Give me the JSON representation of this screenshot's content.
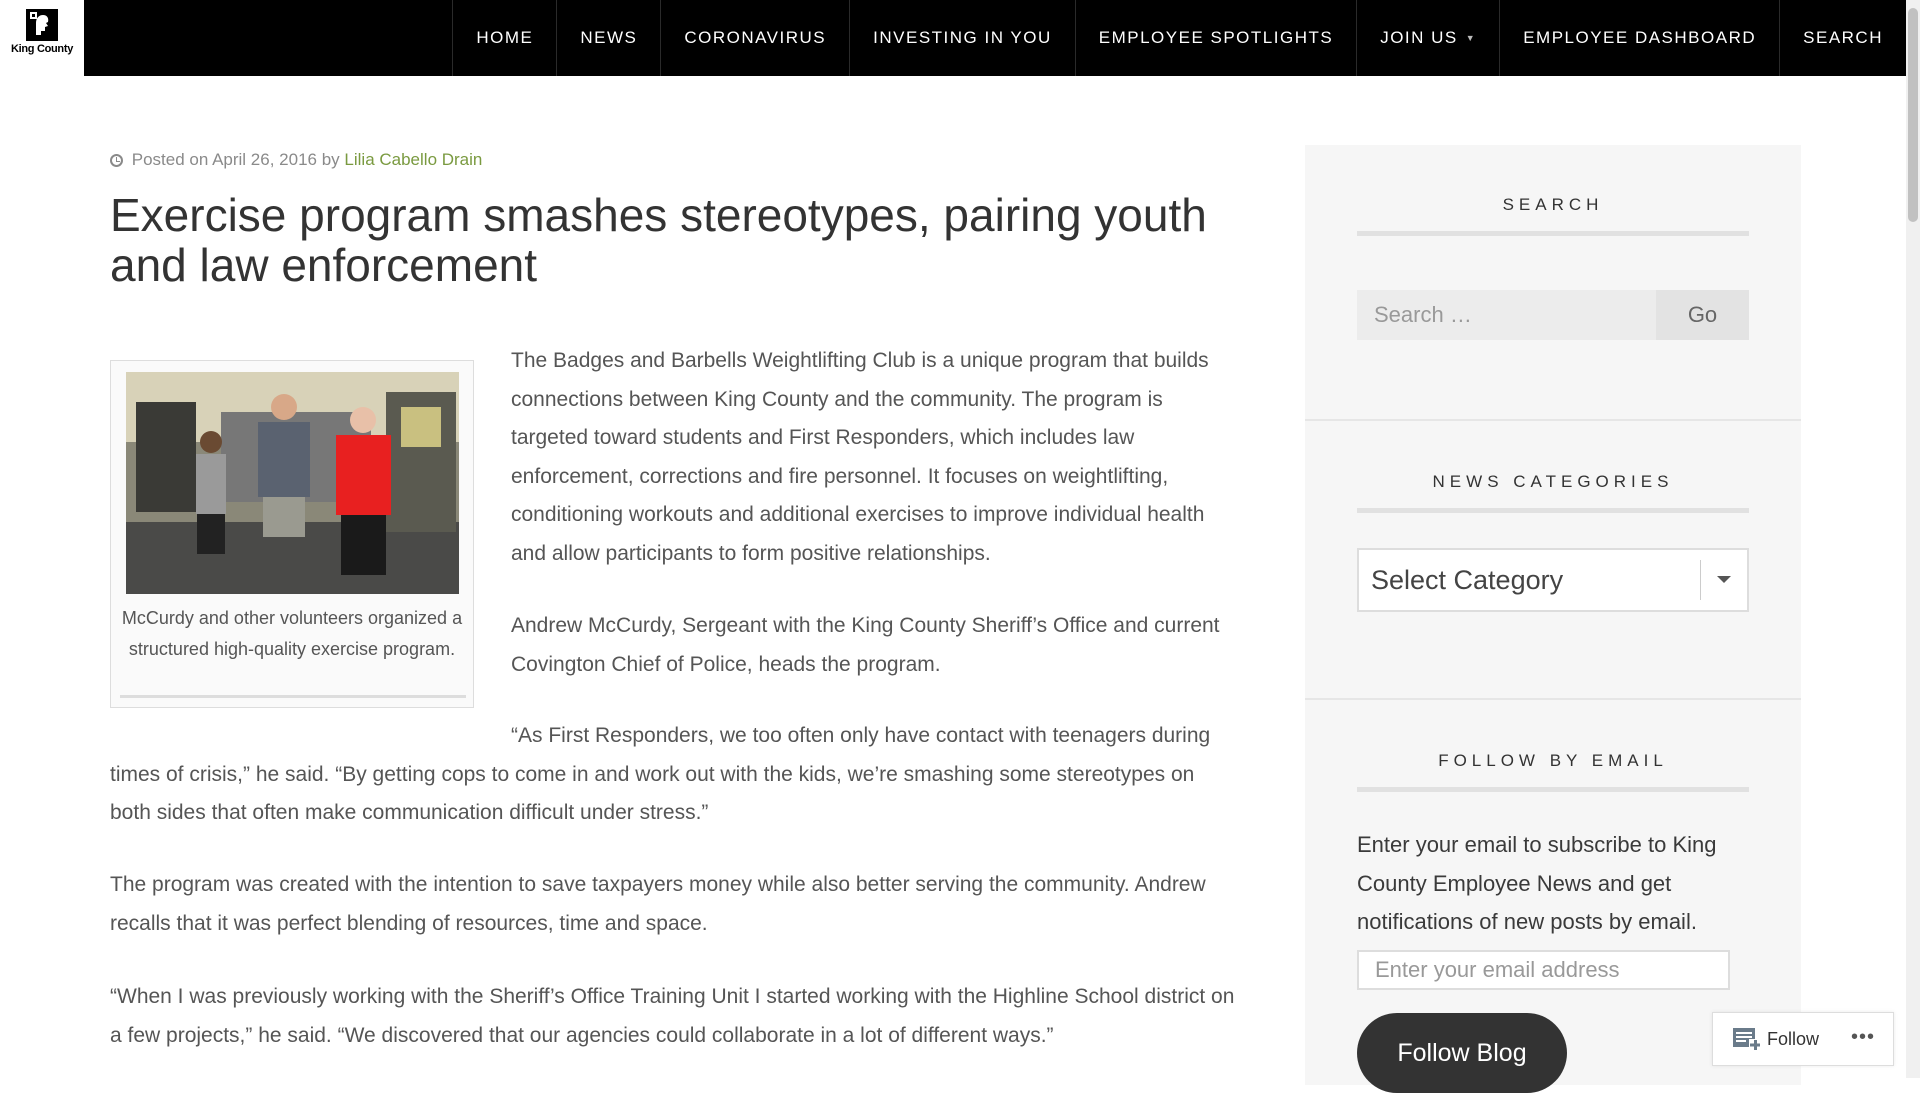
{
  "header": {
    "logo_text": "King County",
    "nav": [
      {
        "label": "HOME"
      },
      {
        "label": "NEWS"
      },
      {
        "label": "CORONAVIRUS"
      },
      {
        "label": "INVESTING IN YOU"
      },
      {
        "label": "EMPLOYEE SPOTLIGHTS"
      },
      {
        "label": "JOIN US"
      },
      {
        "label": "EMPLOYEE DASHBOARD"
      },
      {
        "label": "SEARCH"
      }
    ]
  },
  "article": {
    "meta_prefix": "Posted on April 26, 2016 by",
    "author": "Lilia Cabello Drain",
    "title": "Exercise program smashes stereotypes, pairing youth and law enforcement",
    "figure_caption": "McCurdy and other volunteers organized a structured high-quality exercise program.",
    "paragraphs": [
      "The Badges and Barbells Weightlifting Club is a unique program that builds connections between King County and the community. The program is targeted toward students and First Responders, which includes law enforcement, corrections and fire personnel. It focuses on weightlifting, conditioning workouts and additional exercises to improve individual health and allow participants to form positive relationships.",
      "Andrew McCurdy, Sergeant with the King County Sheriff’s Office and current Covington Chief of Police, heads the program.",
      "“As First Responders, we too often only have contact with teenagers during times of crisis,” he said. “By getting cops to come in and work out with the kids, we’re smashing some stereotypes on both sides that often make communication difficult under stress.”",
      "The program was created with the intention to save taxpayers money while also better serving the community. Andrew recalls that it was perfect blending of resources, time and space.",
      "“When I was previously working with the Sheriff’s Office Training Unit I started working with the Highline School district on a few projects,” he said. “We discovered that our agencies could collaborate in a lot of different ways.”"
    ]
  },
  "sidebar": {
    "search": {
      "title": "SEARCH",
      "placeholder": "Search …",
      "button": "Go"
    },
    "categories": {
      "title": "NEWS CATEGORIES",
      "selected": "Select Category"
    },
    "follow": {
      "title": "FOLLOW BY EMAIL",
      "text": "Enter your email to subscribe to King County Employee News and get notifications of new posts by email.",
      "email_placeholder": "Enter your email address",
      "button": "Follow Blog"
    }
  },
  "wp_follow": {
    "label": "Follow",
    "more": "•••"
  },
  "colors": {
    "nav_bg": "#000000",
    "link": "#7a9a40",
    "sidebar_bg": "#f6f6f6",
    "button_dark": "#333333"
  }
}
